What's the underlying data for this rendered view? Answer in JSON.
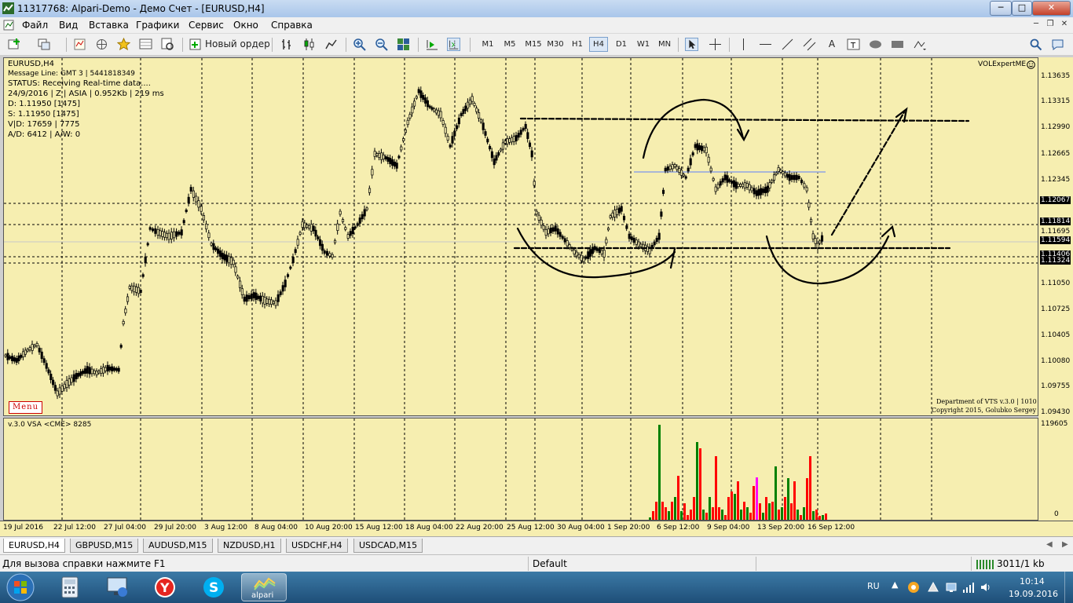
{
  "window": {
    "title": "11317768: Alpari-Demo - Демо Счет - [EURUSD,H4]",
    "minimize": "─",
    "maximize": "□",
    "close": "✕"
  },
  "menu": {
    "items": [
      "Файл",
      "Вид",
      "Вставка",
      "Графики",
      "Сервис",
      "Окно",
      "Справка"
    ]
  },
  "toolbar": {
    "new_order": "Новый ордер",
    "timeframes": [
      "M1",
      "M5",
      "M15",
      "M30",
      "H1",
      "H4",
      "D1",
      "W1",
      "MN"
    ],
    "active_timeframe": "H4"
  },
  "chart": {
    "symbol": "EURUSD,H4",
    "info_lines": [
      "Message Line: GMT 3 | 5441818349",
      "STATUS:  Receiving Real-time data....",
      "24/9/2016 | Z | ASIA | 0.952Kb | 219 ms",
      "D: 1.11950  [1475]",
      "S: 1.11950  [1475]",
      "V|D: 17659 | 7775",
      "A/D: 6412 | A/W: 0"
    ],
    "expert": "VOLExpertME",
    "menu_button": "Menu",
    "copyright_1": "Department of VTS  v.3.0 | 1010",
    "copyright_2": "Copyright 2015, Golubko Sergey",
    "indicator_label": "v.3.0 VSA <CME> 8285",
    "indicator_max": "119605",
    "indicator_zero": "0",
    "price_labels": [
      "1.13635",
      "1.13315",
      "1.12990",
      "1.12665",
      "1.12345",
      "1.12067",
      "1.11814",
      "1.11695",
      "1.11594",
      "1.11406",
      "1.11324",
      "1.11050",
      "1.10725",
      "1.10405",
      "1.10080",
      "1.09755",
      "1.09430"
    ],
    "time_labels": [
      "19 Jul 2016",
      "22 Jul 12:00",
      "27 Jul 04:00",
      "29 Jul 20:00",
      "3 Aug 12:00",
      "8 Aug 04:00",
      "10 Aug 20:00",
      "15 Aug 12:00",
      "18 Aug 04:00",
      "22 Aug 20:00",
      "25 Aug 12:00",
      "30 Aug 04:00",
      "1 Sep 20:00",
      "6 Sep 12:00",
      "9 Sep 04:00",
      "13 Sep 20:00",
      "16 Sep 12:00"
    ],
    "colors": {
      "background": "#f6eeb0",
      "up_volume": "#008000",
      "down_volume": "#ff0000",
      "climax_volume": "#ff00ff"
    }
  },
  "tabs": [
    "EURUSD,H4",
    "GBPUSD,M15",
    "AUDUSD,M15",
    "NZDUSD,H1",
    "USDCHF,H4",
    "USDCAD,M15"
  ],
  "status": {
    "help": "Для вызова справки нажмите F1",
    "profile": "Default",
    "traffic": "3011/1 kb"
  },
  "taskbar": {
    "lang": "RU",
    "time": "10:14",
    "date": "19.09.2016",
    "alpari_label": "alpari"
  }
}
